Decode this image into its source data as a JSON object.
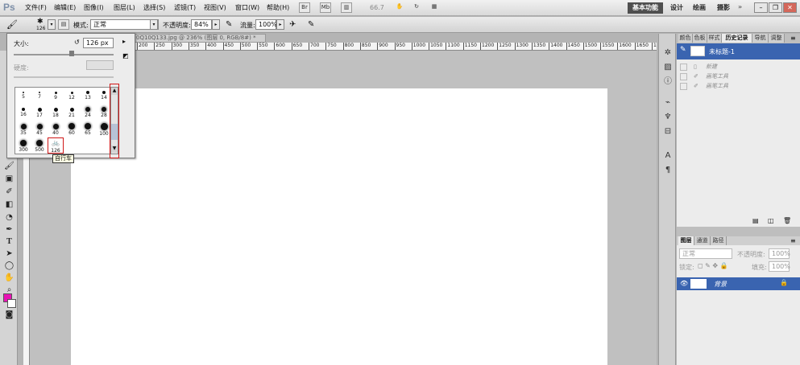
{
  "app": {
    "logo": "Ps"
  },
  "menu": [
    "文件(F)",
    "编辑(E)",
    "图像(I)",
    "图层(L)",
    "选择(S)",
    "滤镜(T)",
    "视图(V)",
    "窗口(W)",
    "帮助(H)"
  ],
  "appbar": {
    "br_label": "Br",
    "mb_label": "Mb",
    "zoom": "66.7",
    "workspaces": {
      "active": "基本功能",
      "items": [
        "设计",
        "绘画",
        "摄影"
      ]
    }
  },
  "options": {
    "brush_size": "126",
    "mode_label": "模式:",
    "mode_value": "正常",
    "opacity_label": "不透明度:",
    "opacity_value": "84%",
    "flow_label": "流量:",
    "flow_value": "100%"
  },
  "document": {
    "tab_title": "0Q10Q133.jpg @ 236% (图层 0, RGB/8#) *"
  },
  "ruler": [
    "200",
    "250",
    "300",
    "350",
    "400",
    "450",
    "500",
    "550",
    "600",
    "650",
    "700",
    "750",
    "800",
    "850",
    "900",
    "950",
    "1000",
    "1050",
    "1100",
    "1150",
    "1200",
    "1250",
    "1300",
    "1350",
    "1400",
    "1450",
    "1500",
    "1550",
    "1600",
    "1650",
    "170"
  ],
  "brush_picker": {
    "size_label": "大小:",
    "size_value": "126 px",
    "hardness_label": "硬度:",
    "brushes": [
      {
        "n": "5",
        "d": 2
      },
      {
        "n": "7",
        "d": 2
      },
      {
        "n": "9",
        "d": 3
      },
      {
        "n": "12",
        "d": 3
      },
      {
        "n": "13",
        "d": 4
      },
      {
        "n": "14",
        "d": 4
      },
      {
        "n": "16",
        "d": 4
      },
      {
        "n": "17",
        "d": 5
      },
      {
        "n": "18",
        "d": 5
      },
      {
        "n": "21",
        "d": 5
      },
      {
        "n": "24",
        "d": 6
      },
      {
        "n": "28",
        "d": 6
      },
      {
        "n": "35",
        "d": 7
      },
      {
        "n": "45",
        "d": 7
      },
      {
        "n": "40",
        "d": 7
      },
      {
        "n": "60",
        "d": 8
      },
      {
        "n": "65",
        "d": 8
      },
      {
        "n": "100",
        "d": 9
      },
      {
        "n": "300",
        "d": 8
      },
      {
        "n": "500",
        "d": 8
      },
      {
        "n": "126",
        "d": 0,
        "custom": true
      }
    ],
    "tooltip": "自行车"
  },
  "history_panel": {
    "tabs": [
      "颜色",
      "色板",
      "样式",
      "历史记录",
      "导航",
      "调整"
    ],
    "active_tab": "历史记录",
    "snapshot": "未标题-1",
    "items": [
      "新建",
      "画笔工具",
      "画笔工具"
    ]
  },
  "layers_panel": {
    "tabs": [
      "图层",
      "通道",
      "路径"
    ],
    "blend_mode": "正常",
    "opacity_label": "不透明度:",
    "opacity_value": "100%",
    "lock_label": "锁定:",
    "fill_label": "填充:",
    "fill_value": "100%",
    "layer_name": "背景"
  },
  "colors": {
    "foreground": "#e812b4",
    "background": "#ffffff",
    "highlight": "#3a64b0",
    "annotation": "#d01717"
  }
}
